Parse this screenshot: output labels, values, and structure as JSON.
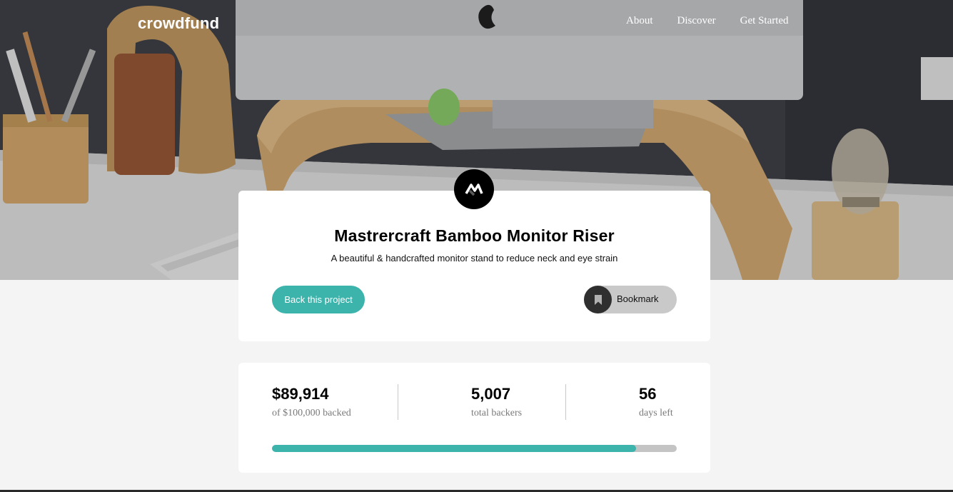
{
  "header": {
    "logo": "crowdfund",
    "nav": [
      "About",
      "Discover",
      "Get Started"
    ]
  },
  "project": {
    "title": "Mastrercraft Bamboo Monitor Riser",
    "subtitle": "A beautiful & handcrafted monitor stand to reduce neck and eye strain",
    "back_button": "Back this project",
    "bookmark_button": "Bookmark",
    "brand_icon": "mastercraft-logo-icon"
  },
  "stats": {
    "backed_value": "$89,914",
    "backed_label": "of $100,000 backed",
    "backers_value": "5,007",
    "backers_label": "total backers",
    "days_value": "56",
    "days_label": "days left",
    "progress": 0.899
  },
  "colors": {
    "accent": "#3cb3ab",
    "dark": "#2f2f2f",
    "bookmark_bg": "#c9c9c9"
  }
}
